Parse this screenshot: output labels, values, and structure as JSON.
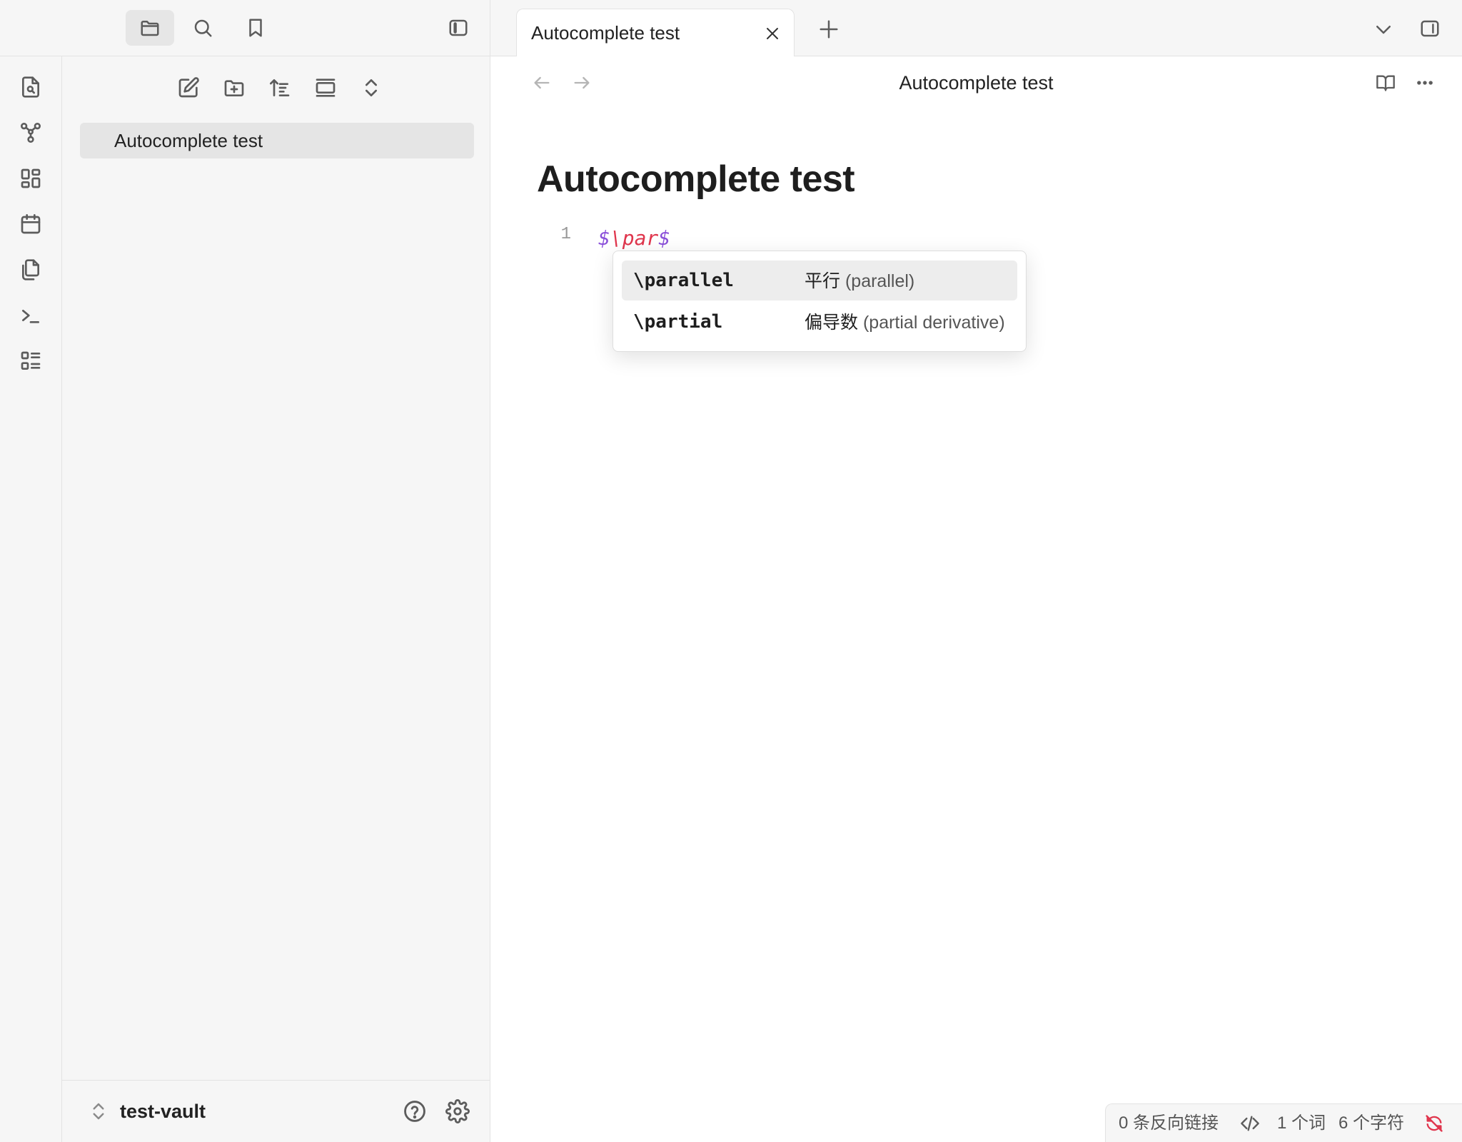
{
  "left_header": {
    "icons": [
      "folder-icon",
      "search-icon",
      "bookmark-icon",
      "sidebar-toggle-icon"
    ]
  },
  "ribbon": {
    "icons": [
      "file-search-icon",
      "graph-icon",
      "dashboard-icon",
      "calendar-icon",
      "copy-files-icon",
      "terminal-icon",
      "list-icon"
    ]
  },
  "sidebar": {
    "actions": [
      "new-note-icon",
      "new-folder-icon",
      "sort-icon",
      "collapse-view-icon",
      "expand-collapse-icon"
    ],
    "files": [
      {
        "name": "Autocomplete test",
        "selected": true
      }
    ],
    "vault_name": "test-vault"
  },
  "tabs": [
    {
      "title": "Autocomplete test",
      "active": true
    }
  ],
  "view_header": {
    "title": "Autocomplete test"
  },
  "editor": {
    "note_title": "Autocomplete test",
    "line_number": "1",
    "line_dollar_open": "$",
    "line_command": "\\par",
    "line_dollar_close": "$"
  },
  "suggestions": [
    {
      "command": "\\parallel",
      "desc_cn": "平行",
      "desc_en": "(parallel)",
      "selected": true
    },
    {
      "command": "\\partial",
      "desc_cn": "偏导数",
      "desc_en": "(partial derivative)",
      "selected": false
    }
  ],
  "status_bar": {
    "backlinks": "0 条反向链接",
    "words": "1 个词",
    "chars": "6 个字符"
  },
  "colors": {
    "math_dollar": "#8a4fd9",
    "math_command": "#e0364d",
    "sync_error": "#e0364d"
  }
}
